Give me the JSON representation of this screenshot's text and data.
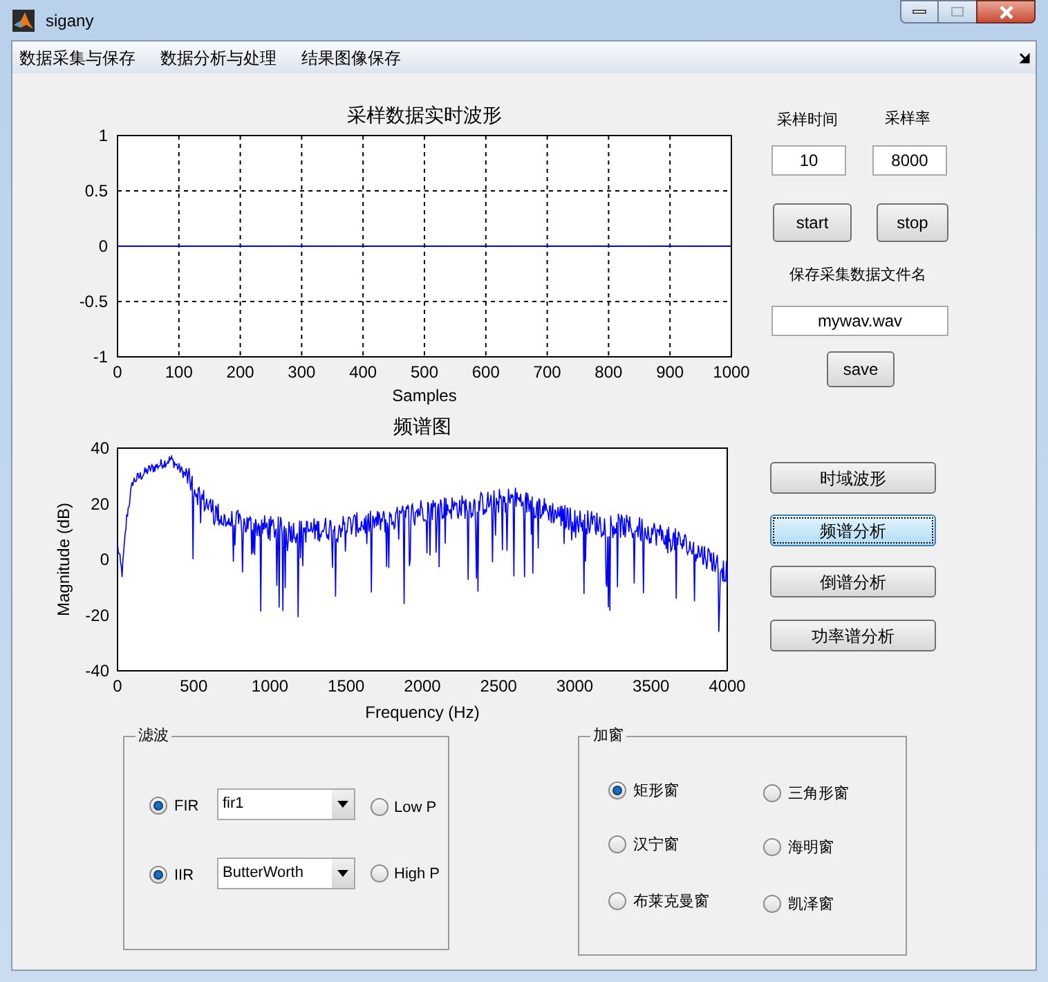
{
  "window": {
    "title": "sigany"
  },
  "menu": [
    "数据采集与保存",
    "数据分析与处理",
    "结果图像保存"
  ],
  "waveform": {
    "chart_data": {
      "type": "line",
      "title": "采样数据实时波形",
      "xlabel": "Samples",
      "x": [
        0,
        1000
      ],
      "series": [
        {
          "color": "#0000ff",
          "values": [
            0,
            0
          ]
        }
      ],
      "xlim": [
        0,
        1000
      ],
      "ylim": [
        -1,
        1
      ],
      "grid": true,
      "xticks": [
        0,
        100,
        200,
        300,
        400,
        500,
        600,
        700,
        800,
        900,
        1000
      ],
      "yticks": [
        -1,
        -0.5,
        0,
        0.5,
        1
      ]
    }
  },
  "spectrum": {
    "title": "频谱图",
    "xlabel": "Frequency (Hz)",
    "ylabel": "Magnitude (dB)",
    "xtick_labels": [
      "0",
      "500",
      "1000",
      "1500",
      "2000",
      "2500",
      "3000",
      "3500",
      "4000"
    ],
    "ytick_labels": [
      "40",
      "20",
      "0",
      "-20",
      "-40"
    ]
  },
  "sampling": {
    "time_label": "采样时间",
    "rate_label": "采样率",
    "time_value": "10",
    "rate_value": "8000"
  },
  "acquire_buttons": [
    "start",
    "stop"
  ],
  "file": {
    "label": "保存采集数据文件名",
    "value": "mywav.wav",
    "button": "save"
  },
  "analysis_buttons": [
    {
      "label": "时域波形",
      "focused": false
    },
    {
      "label": "频谱分析",
      "focused": true
    },
    {
      "label": "倒谱分析",
      "focused": false
    },
    {
      "label": "功率谱分析",
      "focused": false
    }
  ],
  "filter_panel": {
    "title": "滤波",
    "types": [
      {
        "label": "FIR",
        "selected": true,
        "method": "fir1"
      },
      {
        "label": "IIR",
        "selected": true,
        "method": "ButterWorth"
      }
    ],
    "bands": [
      {
        "label": "Low P",
        "selected": false
      },
      {
        "label": "High P",
        "selected": false
      }
    ]
  },
  "window_panel": {
    "title": "加窗",
    "options": [
      {
        "label": "矩形窗",
        "selected": true
      },
      {
        "label": "三角形窗",
        "selected": false
      },
      {
        "label": "汉宁窗",
        "selected": false
      },
      {
        "label": "海明窗",
        "selected": false
      },
      {
        "label": "布莱克曼窗",
        "selected": false
      },
      {
        "label": "凯泽窗",
        "selected": false
      }
    ]
  }
}
